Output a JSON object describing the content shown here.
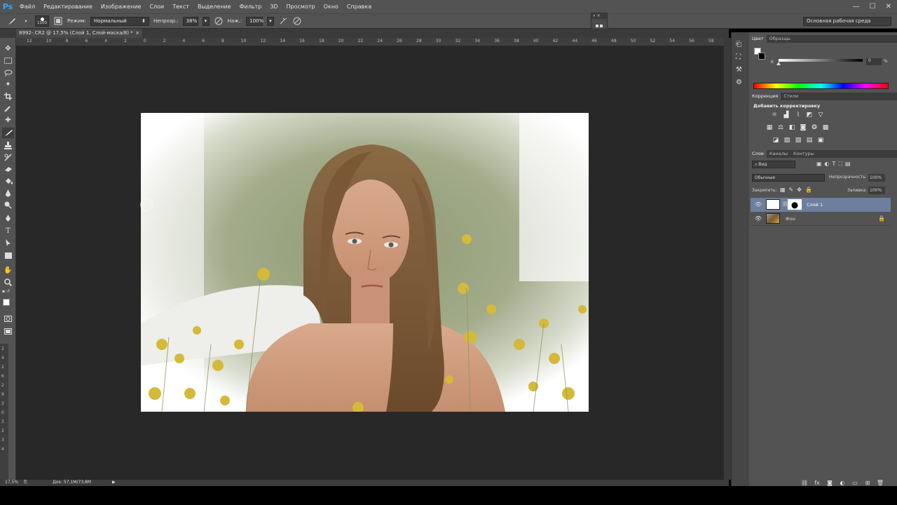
{
  "app": {
    "logo": "Ps"
  },
  "menu": [
    "Файл",
    "Редактирование",
    "Изображение",
    "Слои",
    "Текст",
    "Выделение",
    "Фильтр",
    "3D",
    "Просмотр",
    "Окно",
    "Справка"
  ],
  "window_controls": [
    "—",
    "☐",
    "✕"
  ],
  "options": {
    "brush_size": "1100",
    "mode_label": "Режим:",
    "mode_value": "Нормальный",
    "opacity_label": "Непрозр.:",
    "opacity_value": "38%",
    "flow_label": "Наж.:",
    "flow_value": "100%",
    "workspace": "Основная рабочая среда"
  },
  "document": {
    "tab_title": "8992-.CR2 @ 17,5% (Слой 1, Слой-маска/8) *",
    "close": "×"
  },
  "ruler_h": [
    "12",
    "10",
    "8",
    "6",
    "4",
    "2",
    "0",
    "2",
    "4",
    "6",
    "8",
    "10",
    "12",
    "14",
    "16",
    "18",
    "20",
    "22",
    "24",
    "26",
    "28",
    "30",
    "32",
    "34",
    "36",
    "38",
    "40",
    "42",
    "44",
    "46",
    "48",
    "50",
    "52",
    "54",
    "56",
    "58"
  ],
  "ruler_v": [
    "2",
    "4",
    "2",
    "6",
    "2",
    "8",
    "3",
    "0",
    "3",
    "2",
    "3",
    "4"
  ],
  "status": {
    "zoom": "17,5%",
    "doc": "Док: 57,1M/73,8M"
  },
  "color_panel": {
    "tabs": [
      "Цвет",
      "Образцы"
    ],
    "channel": "K",
    "value": "0",
    "unit": "%"
  },
  "adjust_panel": {
    "tabs": [
      "Коррекция",
      "Стили"
    ],
    "add_label": "Добавить корректировку"
  },
  "layers_panel": {
    "tabs": [
      "Слои",
      "Каналы",
      "Контуры"
    ],
    "filter": "Вид",
    "blend": "Обычные",
    "opacity_label": "Непрозрачность:",
    "opacity_value": "100%",
    "lock_label": "Закрепить:",
    "fill_label": "Заливка:",
    "fill_value": "100%",
    "layers": [
      {
        "name": "Слой 1"
      },
      {
        "name": "Фон"
      }
    ]
  }
}
